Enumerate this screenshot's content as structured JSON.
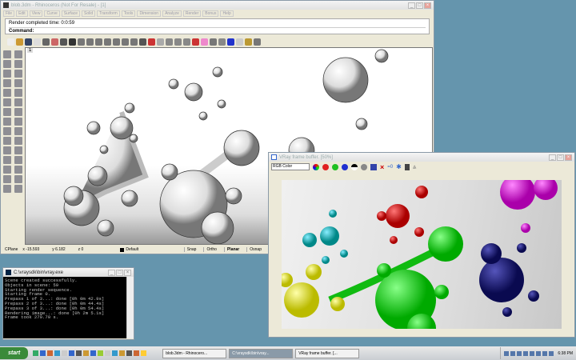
{
  "rhino": {
    "title": "blob.3dm - Rhinoceros (Not For Resale) - [1]",
    "menu": [
      "File",
      "Edit",
      "View",
      "Curve",
      "Surface",
      "Solid",
      "Transform",
      "Tools",
      "Dimension",
      "Analyze",
      "Render",
      "Bonus",
      "Help"
    ],
    "history": "Render completed time: 0:0:59",
    "command_label": "Command:",
    "viewport_label": "1",
    "status": {
      "cplane": "CPlane",
      "x": "x -15.593",
      "y": "y 6.182",
      "z": "z 0",
      "layer": "Default",
      "snap": "Snap",
      "ortho": "Ortho",
      "planar": "Planar",
      "osnap": "Osnap"
    }
  },
  "console": {
    "title": "C:\\vraysdk\\bin\\vray.exe",
    "lines": [
      "Scene created successfully.",
      "Objects in scene: 59",
      "Starting render sequence.",
      "Starting frame 0.",
      "Prepass 1 of 3...: done [0h 0m 42.9s]",
      "Prepass 2 of 3...: done [0h 0m 44.4s]",
      "Prepass 3 of 3...: done [0h 0m 54.4s]",
      "Rendering image...: done [0h 2m 5.1s]",
      "Frame took 270.70 s."
    ]
  },
  "vray": {
    "title": "VRay frame buffer. [50%]",
    "channel": "RGB Color",
    "colors": {
      "red": "#c01818",
      "green": "#1ec81e",
      "blue": "#1a1a8a",
      "yellow": "#e8e010",
      "cyan": "#18b8c8",
      "magenta": "#d818d0"
    }
  },
  "taskbar": {
    "start": "start",
    "tasks": [
      "blob.3dm - Rhinocero...",
      "C:\\vraysdk\\bin\\vray...",
      "VRay frame buffer. [..."
    ],
    "clock": "6:38 PM"
  }
}
